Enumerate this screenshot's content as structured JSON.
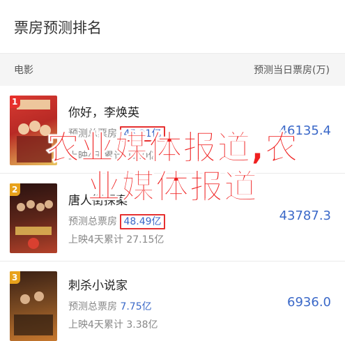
{
  "header": {
    "title": "票房预测排名"
  },
  "columns": {
    "left": "电影",
    "right": "预测当日票房(万)"
  },
  "movies": [
    {
      "rank": "1",
      "title": "你好，李焕英",
      "forecast_label": "预测总票房",
      "forecast_value": "45.21亿",
      "released": "上映4天累计 12.0亿",
      "daily_value": "46135.4",
      "poster_colors": [
        "#c9332d",
        "#e8c25a"
      ]
    },
    {
      "rank": "2",
      "title": "唐人街探案",
      "forecast_label": "预测总票房",
      "forecast_value": "48.49亿",
      "released": "上映4天累计 27.15亿",
      "daily_value": "43787.3",
      "poster_colors": [
        "#3a1a18",
        "#b4412a"
      ]
    },
    {
      "rank": "3",
      "title": "刺杀小说家",
      "forecast_label": "预测总票房",
      "forecast_value": "7.75亿",
      "released": "上映4天累计 3.38亿",
      "daily_value": "6936.0",
      "poster_colors": [
        "#4a2a18",
        "#c7782e"
      ]
    }
  ],
  "watermark": {
    "line1": "农业媒体报道,农",
    "line2": "业媒体报道"
  }
}
